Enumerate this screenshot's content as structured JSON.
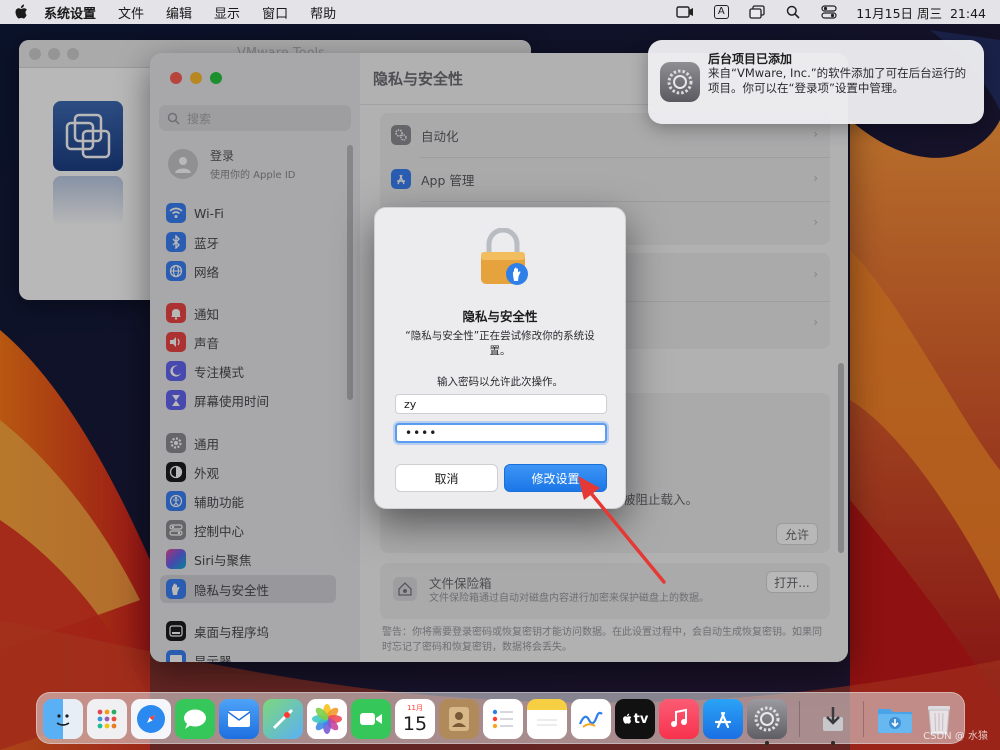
{
  "menubar": {
    "app_name": "系统设置",
    "menus": [
      "文件",
      "编辑",
      "显示",
      "窗口",
      "帮助"
    ],
    "input_method": "A",
    "datetime": "11月15日 周三  21:44"
  },
  "vmware_window": {
    "title": "VMware Tools"
  },
  "settings": {
    "search_placeholder": "搜索",
    "login": {
      "title": "登录",
      "subtitle": "使用你的 Apple ID"
    },
    "sidebar_items": [
      {
        "label": "Wi-Fi",
        "icon": "wifi-icon",
        "color": "#3b82f6"
      },
      {
        "label": "蓝牙",
        "icon": "bluetooth-icon",
        "color": "#3b82f6"
      },
      {
        "label": "网络",
        "icon": "globe-icon",
        "color": "#3b82f6"
      },
      {
        "label": "通知",
        "icon": "bell-icon",
        "color": "#ef4444"
      },
      {
        "label": "声音",
        "icon": "speaker-icon",
        "color": "#ef4444"
      },
      {
        "label": "专注模式",
        "icon": "moon-icon",
        "color": "#6366f1"
      },
      {
        "label": "屏幕使用时间",
        "icon": "hourglass-icon",
        "color": "#6366f1"
      },
      {
        "label": "通用",
        "icon": "gear-icon",
        "color": "#8e8e93"
      },
      {
        "label": "外观",
        "icon": "appearance-icon",
        "color": "#1d1d1f"
      },
      {
        "label": "辅助功能",
        "icon": "accessibility-icon",
        "color": "#3b82f6"
      },
      {
        "label": "控制中心",
        "icon": "control-center-icon",
        "color": "#8e8e93"
      },
      {
        "label": "Siri与聚焦",
        "icon": "siri-icon",
        "color": "#a855f7"
      },
      {
        "label": "隐私与安全性",
        "icon": "hand-icon",
        "color": "#3b82f6"
      },
      {
        "label": "桌面与程序坞",
        "icon": "dock-icon",
        "color": "#1d1d1f"
      },
      {
        "label": "显示器",
        "icon": "display-icon",
        "color": "#3b82f6"
      }
    ],
    "content": {
      "title": "隐私与安全性",
      "rows": [
        {
          "label": "自动化",
          "icon": "gears-icon"
        },
        {
          "label": "App 管理",
          "icon": "app-store-icon"
        }
      ],
      "blocked_text": "被阻止载入。",
      "allow_button": "允许",
      "filevault": {
        "title": "文件保险箱",
        "description": "文件保险箱通过自动对磁盘内容进行加密来保护磁盘上的数据。",
        "open_button": "打开..."
      },
      "warning": "警告：你将需要登录密码或恢复密钥才能访问数据。在此设置过程中，会自动生成恢复密钥。如果同时忘记了密码和恢复密钥，数据将会丢失。"
    }
  },
  "notification": {
    "title": "后台项目已添加",
    "body": "来自“VMware, Inc.”的软件添加了可在后台运行的项目。你可以在“登录项”设置中管理。"
  },
  "dialog": {
    "title": "隐私与安全性",
    "message": "“隐私与安全性”正在尝试修改你的系统设置。",
    "prompt": "输入密码以允许此次操作。",
    "username": "zy",
    "password_mask": "••••",
    "cancel_label": "取消",
    "confirm_label": "修改设置"
  },
  "dock": {
    "calendar_month": "11月",
    "calendar_day": "15",
    "tv_label": "tv",
    "apps": [
      "finder",
      "launchpad",
      "safari",
      "messages",
      "mail",
      "maps",
      "photos",
      "facetime",
      "calendar",
      "contacts",
      "reminders",
      "notes",
      "freeform",
      "tv",
      "music",
      "app-store",
      "system-settings",
      "preview",
      "downloads",
      "trash"
    ]
  },
  "watermark": "CSDN @ 水猿",
  "colors": {
    "accent": "#1b77e8",
    "arrow": "#e53935",
    "traffic_red": "#ff5f57",
    "traffic_yellow": "#febc2e",
    "traffic_green": "#28c840"
  }
}
